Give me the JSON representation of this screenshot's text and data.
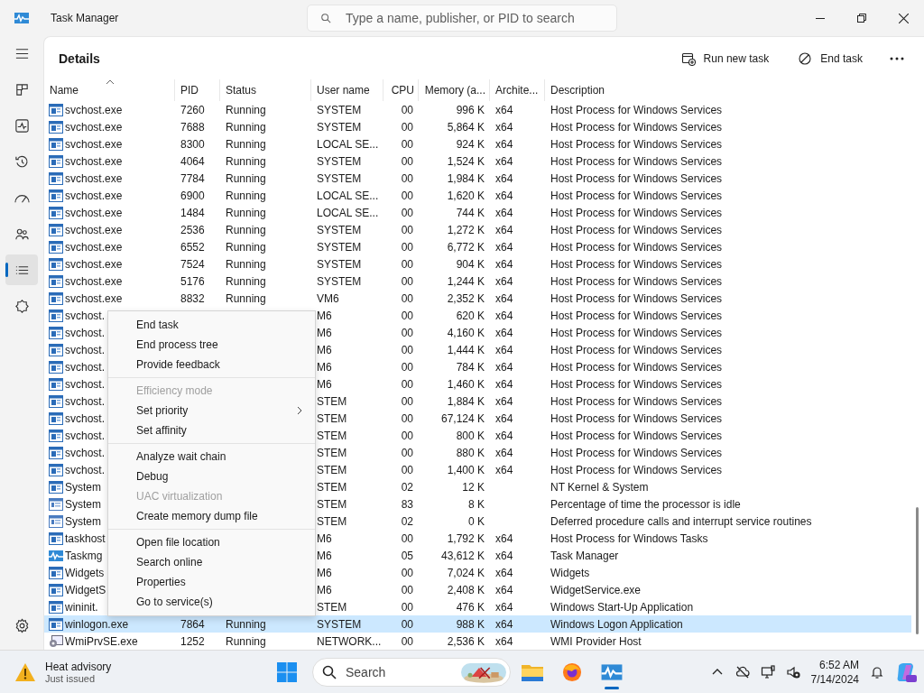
{
  "window": {
    "title": "Task Manager"
  },
  "search": {
    "placeholder": "Type a name, publisher, or PID to search"
  },
  "nav": [
    {
      "kind": "processes",
      "selected": false
    },
    {
      "kind": "performance",
      "selected": false
    },
    {
      "kind": "history",
      "selected": false
    },
    {
      "kind": "startup",
      "selected": false
    },
    {
      "kind": "users",
      "selected": false
    },
    {
      "kind": "details",
      "selected": true
    },
    {
      "kind": "services",
      "selected": false
    }
  ],
  "nav_bottom": [
    {
      "kind": "settings",
      "selected": false
    }
  ],
  "page": {
    "title": "Details"
  },
  "actions": [
    {
      "kind": "run",
      "label": "Run new task"
    },
    {
      "kind": "end",
      "label": "End task"
    },
    {
      "kind": "more"
    }
  ],
  "table": {
    "columns": [
      {
        "label": "Name",
        "sorted": true
      },
      {
        "label": "PID",
        "sorted": false
      },
      {
        "label": "Status",
        "sorted": false
      },
      {
        "label": "User name",
        "sorted": false
      },
      {
        "label": "CPU",
        "sorted": false
      },
      {
        "label": "Memory (a...",
        "sorted": false
      },
      {
        "label": "Archite...",
        "sorted": false
      },
      {
        "label": "Description",
        "sorted": false
      }
    ],
    "rows": [
      {
        "kind": "service",
        "name": "svchost.exe",
        "pid": "7260",
        "status": "Running",
        "user": "SYSTEM",
        "cpu": "00",
        "memory": "996 K",
        "arch": "x64",
        "description": "Host Process for Windows Services",
        "selected": false
      },
      {
        "kind": "service",
        "name": "svchost.exe",
        "pid": "7688",
        "status": "Running",
        "user": "SYSTEM",
        "cpu": "00",
        "memory": "5,864 K",
        "arch": "x64",
        "description": "Host Process for Windows Services",
        "selected": false
      },
      {
        "kind": "service",
        "name": "svchost.exe",
        "pid": "8300",
        "status": "Running",
        "user": "LOCAL SE...",
        "cpu": "00",
        "memory": "924 K",
        "arch": "x64",
        "description": "Host Process for Windows Services",
        "selected": false
      },
      {
        "kind": "service",
        "name": "svchost.exe",
        "pid": "4064",
        "status": "Running",
        "user": "SYSTEM",
        "cpu": "00",
        "memory": "1,524 K",
        "arch": "x64",
        "description": "Host Process for Windows Services",
        "selected": false
      },
      {
        "kind": "service",
        "name": "svchost.exe",
        "pid": "7784",
        "status": "Running",
        "user": "SYSTEM",
        "cpu": "00",
        "memory": "1,984 K",
        "arch": "x64",
        "description": "Host Process for Windows Services",
        "selected": false
      },
      {
        "kind": "service",
        "name": "svchost.exe",
        "pid": "6900",
        "status": "Running",
        "user": "LOCAL SE...",
        "cpu": "00",
        "memory": "1,620 K",
        "arch": "x64",
        "description": "Host Process for Windows Services",
        "selected": false
      },
      {
        "kind": "service",
        "name": "svchost.exe",
        "pid": "1484",
        "status": "Running",
        "user": "LOCAL SE...",
        "cpu": "00",
        "memory": "744 K",
        "arch": "x64",
        "description": "Host Process for Windows Services",
        "selected": false
      },
      {
        "kind": "service",
        "name": "svchost.exe",
        "pid": "2536",
        "status": "Running",
        "user": "SYSTEM",
        "cpu": "00",
        "memory": "1,272 K",
        "arch": "x64",
        "description": "Host Process for Windows Services",
        "selected": false
      },
      {
        "kind": "service",
        "name": "svchost.exe",
        "pid": "6552",
        "status": "Running",
        "user": "SYSTEM",
        "cpu": "00",
        "memory": "6,772 K",
        "arch": "x64",
        "description": "Host Process for Windows Services",
        "selected": false
      },
      {
        "kind": "service",
        "name": "svchost.exe",
        "pid": "7524",
        "status": "Running",
        "user": "SYSTEM",
        "cpu": "00",
        "memory": "904 K",
        "arch": "x64",
        "description": "Host Process for Windows Services",
        "selected": false
      },
      {
        "kind": "service",
        "name": "svchost.exe",
        "pid": "5176",
        "status": "Running",
        "user": "SYSTEM",
        "cpu": "00",
        "memory": "1,244 K",
        "arch": "x64",
        "description": "Host Process for Windows Services",
        "selected": false
      },
      {
        "kind": "service",
        "name": "svchost.exe",
        "pid": "8832",
        "status": "Running",
        "user": "VM6",
        "cpu": "00",
        "memory": "2,352 K",
        "arch": "x64",
        "description": "Host Process for Windows Services",
        "selected": false
      },
      {
        "kind": "service",
        "name": "svchost.",
        "user": "M6",
        "cpu": "00",
        "memory": "620 K",
        "arch": "x64",
        "description": "Host Process for Windows Services",
        "selected": false
      },
      {
        "kind": "service",
        "name": "svchost.",
        "user": "M6",
        "cpu": "00",
        "memory": "4,160 K",
        "arch": "x64",
        "description": "Host Process for Windows Services",
        "selected": false
      },
      {
        "kind": "service",
        "name": "svchost.",
        "user": "M6",
        "cpu": "00",
        "memory": "1,444 K",
        "arch": "x64",
        "description": "Host Process for Windows Services",
        "selected": false
      },
      {
        "kind": "service",
        "name": "svchost.",
        "user": "M6",
        "cpu": "00",
        "memory": "784 K",
        "arch": "x64",
        "description": "Host Process for Windows Services",
        "selected": false
      },
      {
        "kind": "service",
        "name": "svchost.",
        "user": "M6",
        "cpu": "00",
        "memory": "1,460 K",
        "arch": "x64",
        "description": "Host Process for Windows Services",
        "selected": false
      },
      {
        "kind": "service",
        "name": "svchost.",
        "user": "STEM",
        "cpu": "00",
        "memory": "1,884 K",
        "arch": "x64",
        "description": "Host Process for Windows Services",
        "selected": false
      },
      {
        "kind": "service",
        "name": "svchost.",
        "user": "STEM",
        "cpu": "00",
        "memory": "67,124 K",
        "arch": "x64",
        "description": "Host Process for Windows Services",
        "selected": false
      },
      {
        "kind": "service",
        "name": "svchost.",
        "user": "STEM",
        "cpu": "00",
        "memory": "800 K",
        "arch": "x64",
        "description": "Host Process for Windows Services",
        "selected": false
      },
      {
        "kind": "service",
        "name": "svchost.",
        "user": "STEM",
        "cpu": "00",
        "memory": "880 K",
        "arch": "x64",
        "description": "Host Process for Windows Services",
        "selected": false
      },
      {
        "kind": "service",
        "name": "svchost.",
        "user": "STEM",
        "cpu": "00",
        "memory": "1,400 K",
        "arch": "x64",
        "description": "Host Process for Windows Services",
        "selected": false
      },
      {
        "kind": "service",
        "name": "System",
        "user": "STEM",
        "cpu": "02",
        "memory": "12 K",
        "description": "NT Kernel & System",
        "selected": false
      },
      {
        "kind": "system",
        "name": "System",
        "user": "STEM",
        "cpu": "83",
        "memory": "8 K",
        "description": "Percentage of time the processor is idle",
        "selected": false
      },
      {
        "kind": "system",
        "name": "System",
        "user": "STEM",
        "cpu": "02",
        "memory": "0 K",
        "description": "Deferred procedure calls and interrupt service routines",
        "selected": false
      },
      {
        "kind": "service",
        "name": "taskhost",
        "user": "M6",
        "cpu": "00",
        "memory": "1,792 K",
        "arch": "x64",
        "description": "Host Process for Windows Tasks",
        "selected": false
      },
      {
        "kind": "taskmgr",
        "name": "Taskmg",
        "user": "M6",
        "cpu": "05",
        "memory": "43,612 K",
        "arch": "x64",
        "description": "Task Manager",
        "selected": false
      },
      {
        "kind": "service",
        "name": "Widgets",
        "user": "M6",
        "cpu": "00",
        "memory": "7,024 K",
        "arch": "x64",
        "description": "Widgets",
        "selected": false
      },
      {
        "kind": "service",
        "name": "WidgetS",
        "user": "M6",
        "cpu": "00",
        "memory": "2,408 K",
        "arch": "x64",
        "description": "WidgetService.exe",
        "selected": false
      },
      {
        "kind": "service",
        "name": "wininit.",
        "user": "STEM",
        "cpu": "00",
        "memory": "476 K",
        "arch": "x64",
        "description": "Windows Start-Up Application",
        "selected": false
      },
      {
        "kind": "service",
        "name": "winlogon.exe",
        "pid": "7864",
        "status": "Running",
        "user": "SYSTEM",
        "cpu": "00",
        "memory": "988 K",
        "arch": "x64",
        "description": "Windows Logon Application",
        "selected": true
      },
      {
        "kind": "wmi",
        "name": "WmiPrvSE.exe",
        "pid": "1252",
        "status": "Running",
        "user": "NETWORK...",
        "cpu": "00",
        "memory": "2,536 K",
        "arch": "x64",
        "description": "WMI Provider Host",
        "selected": false
      }
    ]
  },
  "context_menu": {
    "groups": [
      [
        {
          "label": "End task",
          "disabled": false,
          "submenu": false
        },
        {
          "label": "End process tree",
          "disabled": false,
          "submenu": false
        },
        {
          "label": "Provide feedback",
          "disabled": false,
          "submenu": false
        }
      ],
      [
        {
          "label": "Efficiency mode",
          "disabled": true,
          "submenu": false
        },
        {
          "label": "Set priority",
          "disabled": false,
          "submenu": true
        },
        {
          "label": "Set affinity",
          "disabled": false,
          "submenu": false
        }
      ],
      [
        {
          "label": "Analyze wait chain",
          "disabled": false,
          "submenu": false
        },
        {
          "label": "Debug",
          "disabled": false,
          "submenu": false
        },
        {
          "label": "UAC virtualization",
          "disabled": true,
          "submenu": false
        },
        {
          "label": "Create memory dump file",
          "disabled": false,
          "submenu": false
        }
      ],
      [
        {
          "label": "Open file location",
          "disabled": false,
          "submenu": false
        },
        {
          "label": "Search online",
          "disabled": false,
          "submenu": false
        },
        {
          "label": "Properties",
          "disabled": false,
          "submenu": false
        },
        {
          "label": "Go to service(s)",
          "disabled": false,
          "submenu": false
        }
      ]
    ]
  },
  "taskbar": {
    "weather": {
      "title": "Heat advisory",
      "subtitle": "Just issued"
    },
    "search": {
      "label": "Search"
    },
    "apps": [
      {
        "kind": "files",
        "active": false
      },
      {
        "kind": "browser",
        "active": false
      },
      {
        "kind": "taskmgr",
        "active": true
      }
    ],
    "clock": {
      "time": "6:52 AM",
      "date": "7/14/2024"
    }
  }
}
